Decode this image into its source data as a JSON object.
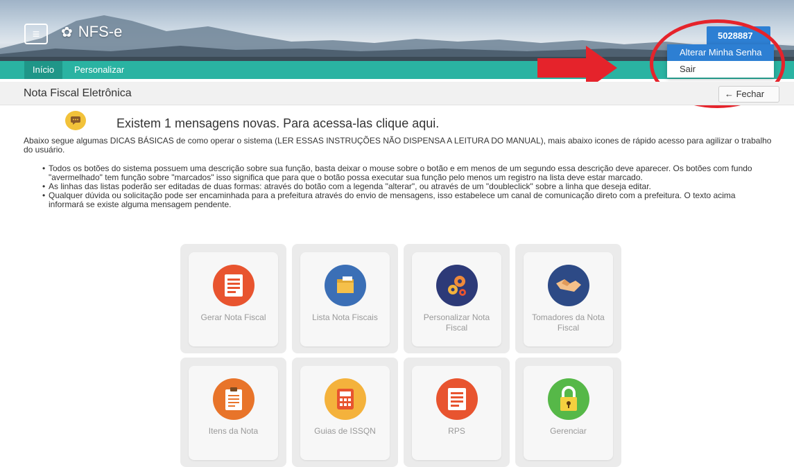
{
  "header": {
    "app_name": "NFS-e",
    "menu_icon": "hamburger-icon",
    "gear_icon": "gear-icon"
  },
  "nav": {
    "items": [
      {
        "label": "Início"
      },
      {
        "label": "Personalizar"
      }
    ]
  },
  "user_menu": {
    "user_id": "5028887",
    "items": [
      {
        "label": "Alterar Minha Senha"
      },
      {
        "label": "Sair"
      }
    ]
  },
  "titlebar": {
    "title": "Nota Fiscal Eletrônica",
    "close_label": "← Fechar"
  },
  "message": {
    "text": "Existem 1 mensagens novas. Para acessa-las clique aqui."
  },
  "intro": "Abaixo segue algumas DICAS BÁSICAS de como operar o sistema (LER ESSAS INSTRUÇÕES NÃO DISPENSA A LEITURA DO MANUAL), mais abaixo icones de rápido acesso para agilizar o trabalho do usuário.",
  "tips": [
    "Todos os botões do sistema possuem uma descrição sobre sua função, basta deixar o mouse sobre o botão e em menos de um segundo essa descrição deve aparecer. Os botões com fundo \"avermelhado\" tem função sobre \"marcados\" isso significa que para que o botão possa executar sua função pelo menos um registro na lista deve estar marcado.",
    "As linhas das listas poderão ser editadas de duas formas: através do botão com a legenda \"alterar\", ou através de um \"doubleclick\" sobre a linha que deseja editar.",
    "Qualquer dúvida ou solicitação pode ser encaminhada para a prefeitura através do envio de mensagens, isso estabelece um canal de comunicação direto com a prefeitura. O texto acima informará se existe alguma mensagem pendente."
  ],
  "tiles": [
    {
      "label": "Gerar Nota Fiscal",
      "icon": "receipt-icon",
      "color": "#e8542f"
    },
    {
      "label": "Lista Nota Fiscais",
      "icon": "box-icon",
      "color": "#3b6fb6"
    },
    {
      "label": "Personalizar Nota Fiscal",
      "icon": "gears-icon",
      "color": "#2d3a78"
    },
    {
      "label": "Tomadores da Nota Fiscal",
      "icon": "handshake-icon",
      "color": "#2d4a86"
    },
    {
      "label": "Itens da Nota",
      "icon": "clipboard-icon",
      "color": "#e8742a"
    },
    {
      "label": "Guias de ISSQN",
      "icon": "calculator-icon",
      "color": "#f4b23c"
    },
    {
      "label": "RPS",
      "icon": "receipt-icon",
      "color": "#e8542f"
    },
    {
      "label": "Gerenciar",
      "icon": "lock-icon",
      "color": "#56b848"
    }
  ],
  "colors": {
    "navbar": "#2ab3a2",
    "accent_blue": "#2d7fd3",
    "annotation_red": "#e5232b"
  }
}
